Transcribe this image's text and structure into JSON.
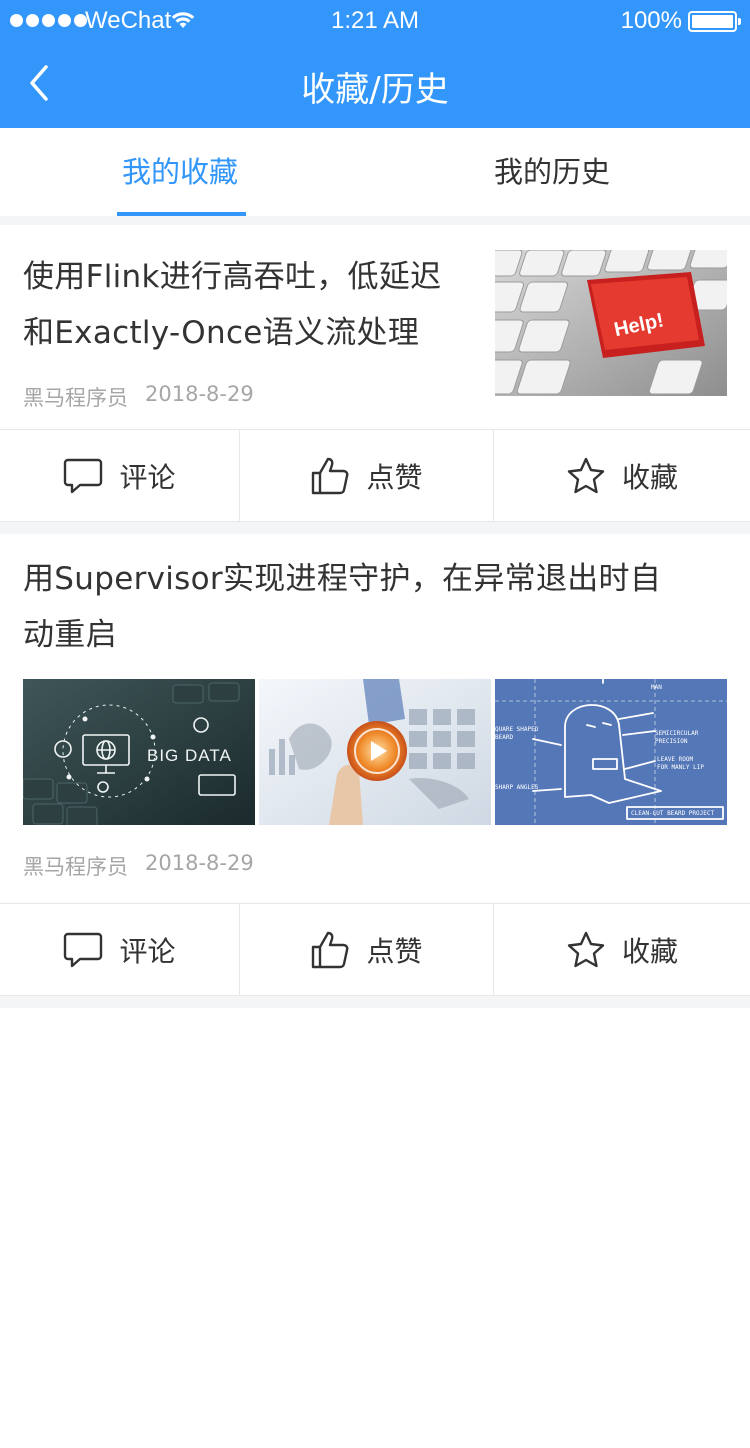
{
  "status_bar": {
    "carrier": "WeChat",
    "time": "1:21 AM",
    "battery": "100%",
    "battery_level": 1.0
  },
  "header": {
    "title": "收藏/历史",
    "back_icon": "chevron-left-icon"
  },
  "tabs": [
    {
      "label": "我的收藏",
      "active": true
    },
    {
      "label": "我的历史",
      "active": false
    }
  ],
  "articles": [
    {
      "title_line1": "使用Flink进行高吞吐，低延迟",
      "title_line2": "和Exactly-Once语义流处理",
      "author": "黑马程序员",
      "date": "2018-8-29",
      "images": [
        "keyboard-help-key-photo"
      ]
    },
    {
      "title_line1": "用Supervisor实现进程守护，在异常退出时自",
      "title_line2": "动重启",
      "author": "黑马程序员",
      "date": "2018-8-29",
      "images": [
        "big-data-keyboard-photo",
        "digital-touch-play-photo",
        "blueprint-ghost-sketch"
      ],
      "image_text": "BIG DATA"
    }
  ],
  "actions": {
    "comment": "评论",
    "like": "点赞",
    "favorite": "收藏"
  },
  "colors": {
    "primary": "#3296fa",
    "text": "#333333",
    "meta": "#a6a6a6",
    "divider": "#e8e8e8",
    "background_gap": "#f4f5f6"
  }
}
